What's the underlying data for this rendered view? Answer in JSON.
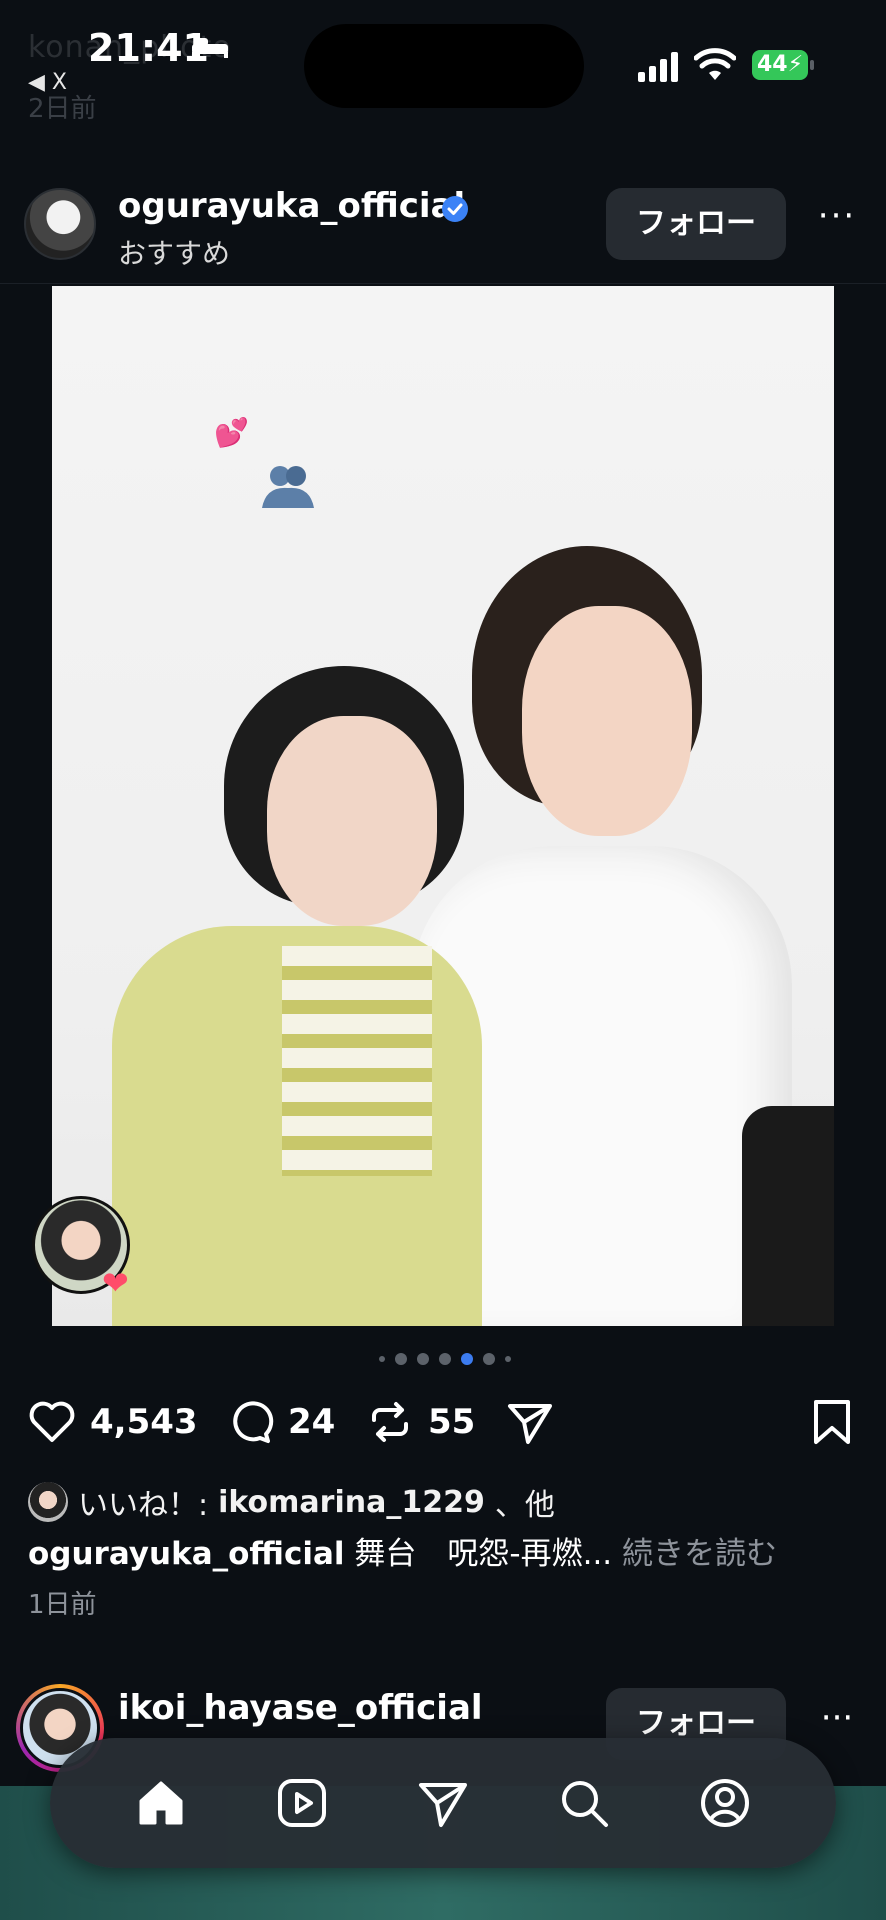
{
  "status_bar": {
    "time": "21:41",
    "back_label": "◀ X",
    "battery": "44",
    "ghost_username": "konan_photo",
    "ghost_time": "2日前"
  },
  "post": {
    "username": "ogurayuka_official",
    "sub_label": "おすすめ",
    "follow_label": "フォロー",
    "more_label": "···",
    "likes_count": "4,543",
    "comments_count": "24",
    "reposts_count": "55",
    "liked_by_prefix": "いいね！: ",
    "liked_by_user": "ikomarina_1229",
    "liked_by_suffix": "、他",
    "caption_user": "ogurayuka_official",
    "caption_text": " 舞台　呪怨-再燃... ",
    "caption_more": "続きを読む",
    "time_ago": "1日前",
    "sticker_hearts": "💕"
  },
  "next_post": {
    "username": "ikoi_hayase_official",
    "follow_label": "フォロー",
    "more_label": "···"
  },
  "carousel": {
    "count": 7,
    "active_index": 4
  },
  "colors": {
    "background": "#0b0f14",
    "verified": "#3b82f6",
    "active_dot": "#3c7cf0",
    "battery": "#34c759"
  },
  "tabs": [
    "home-icon",
    "reels-icon",
    "send-icon",
    "search-icon",
    "profile-icon"
  ]
}
